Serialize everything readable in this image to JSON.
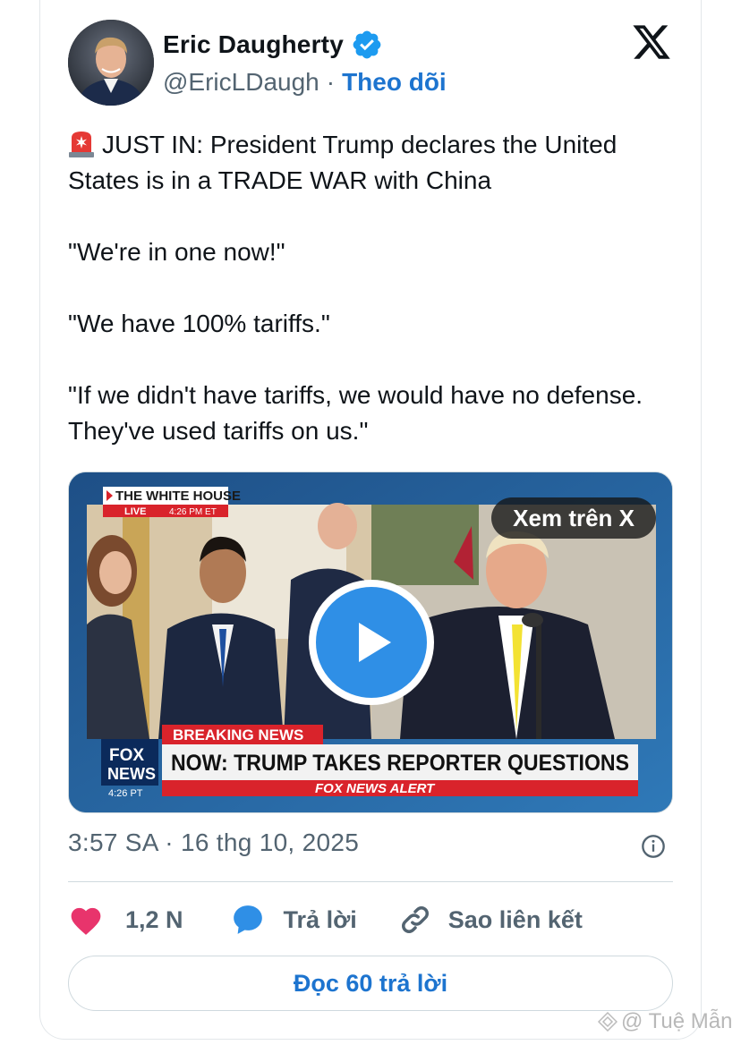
{
  "author": {
    "name": "Eric Daugherty",
    "handle": "@EricLDaugh",
    "separator": "·",
    "follow_label": "Theo dõi"
  },
  "icons": {
    "verified": "verified-badge-icon",
    "platform": "x-logo-icon",
    "siren": "rotating-light-emoji",
    "play": "play-icon",
    "info": "info-icon",
    "like": "heart-icon",
    "reply": "speech-bubble-icon",
    "link": "link-icon"
  },
  "tweet": {
    "line1": "JUST IN: President Trump declares the United States is in a TRADE WAR with China",
    "line2": "\"We're in one now!\"",
    "line3": "\"We have 100% tariffs.\"",
    "line4": "\"If we didn't have tariffs, we would have no defense. They've used tariffs on us.\""
  },
  "media": {
    "view_on_x_label": "Xem trên X",
    "video_text": {
      "location_tag": "THE WHITE HOUSE",
      "live_tag": "LIVE",
      "time_tag": "4:26 PM ET",
      "breaking": "BREAKING NEWS",
      "headline": "NOW: TRUMP TAKES REPORTER QUESTIONS",
      "alert": "FOX NEWS ALERT",
      "logo_line1": "FOX",
      "logo_line2": "NEWS",
      "logo_time": "4:26 PT"
    }
  },
  "timestamp": "3:57 SA · 16 thg 10, 2025",
  "actions": {
    "likes": "1,2 N",
    "reply_label": "Trả lời",
    "copy_link_label": "Sao liên kết"
  },
  "read_replies_label": "Đọc 60 trả lời",
  "watermark": "@ Tuệ Mẫn",
  "colors": {
    "accent": "#1d74cf",
    "like": "#e8346c",
    "reply": "#2f8fe6",
    "muted": "#536471",
    "fox_red": "#d9232b"
  }
}
